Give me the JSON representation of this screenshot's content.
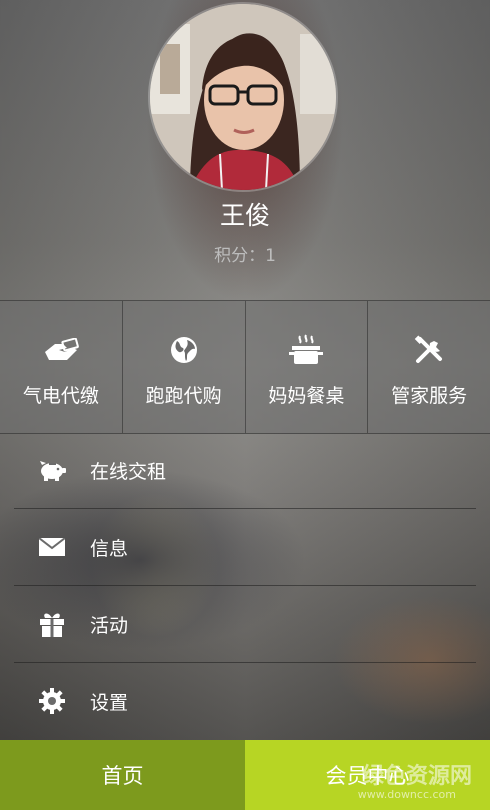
{
  "profile": {
    "name": "王俊",
    "points_label": "积分：",
    "points_value": "1"
  },
  "services": [
    {
      "label": "气电代缴",
      "icon": "payment-icon"
    },
    {
      "label": "跑跑代购",
      "icon": "globe-icon"
    },
    {
      "label": "妈妈餐桌",
      "icon": "cooking-pot-icon"
    },
    {
      "label": "管家服务",
      "icon": "tools-icon"
    }
  ],
  "menu": [
    {
      "label": "在线交租",
      "icon": "piggy-bank-icon"
    },
    {
      "label": "信息",
      "icon": "envelope-icon"
    },
    {
      "label": "活动",
      "icon": "gift-icon"
    },
    {
      "label": "设置",
      "icon": "gear-icon"
    }
  ],
  "tabs": {
    "home": "首页",
    "member": "会员中心"
  },
  "watermark": {
    "text": "绿色资源网",
    "url": "www.downcc.com"
  },
  "colors": {
    "tab_home": "#7d9a1d",
    "tab_member": "#b7d524"
  }
}
